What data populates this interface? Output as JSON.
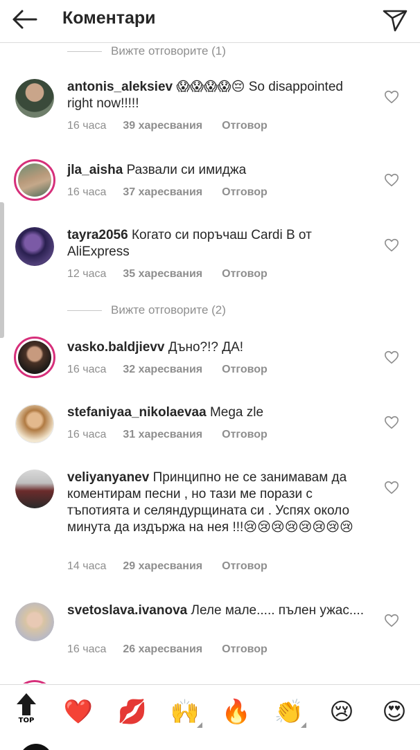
{
  "header": {
    "title": "Коментари",
    "back_icon": "arrow-left-icon",
    "send_icon": "paper-plane-icon"
  },
  "replies_labels": {
    "first": "Вижте отговорите (1)",
    "second": "Вижте отговорите (2)"
  },
  "comments": [
    {
      "user": "antonis_aleksiev",
      "text": "😱😱😱😱😔 So disappointed right now!!!!!",
      "time": "16 часа",
      "likes": "39 харесвания",
      "reply": "Отговор"
    },
    {
      "user": "jla_aisha",
      "text": "Развали си имиджа",
      "time": "16 часа",
      "likes": "37 харесвания",
      "reply": "Отговор"
    },
    {
      "user": "tayra2056",
      "text": "Когато си поръчаш Cardi B от AliExpress",
      "time": "12 часа",
      "likes": "35 харесвания",
      "reply": "Отговор"
    },
    {
      "user": "vasko.baldjievv",
      "text": "Дъно?!? ДА!",
      "time": "16 часа",
      "likes": "32 харесвания",
      "reply": "Отговор"
    },
    {
      "user": "stefaniyaa_nikolaevaa",
      "text": "Mega zle",
      "time": "16 часа",
      "likes": "31 харесвания",
      "reply": "Отговор"
    },
    {
      "user": "veliyanyanev",
      "text": "Принципно не се занимавам да коментирам песни , но тази ме порази с тъпотията и селяндурщината си . Успях около минута да издържа на нея !!!😢😢😢😢😢😢😢😢",
      "time": "14 часа",
      "likes": "29 харесвания",
      "reply": "Отговор"
    },
    {
      "user": "svetoslava.ivanova",
      "text": "Леле мале..... пълен ужас....",
      "time": "16 часа",
      "likes": "26 харесвания",
      "reply": "Отговор"
    }
  ],
  "emoji_bar": {
    "top_label": "TOP",
    "emojis": [
      "❤️",
      "💋",
      "🙌",
      "🔥",
      "👏",
      "😢",
      "😍"
    ]
  },
  "colors": {
    "story_ring": "#d62f7a",
    "muted_text": "#8e8e8e",
    "primary_text": "#262626"
  }
}
